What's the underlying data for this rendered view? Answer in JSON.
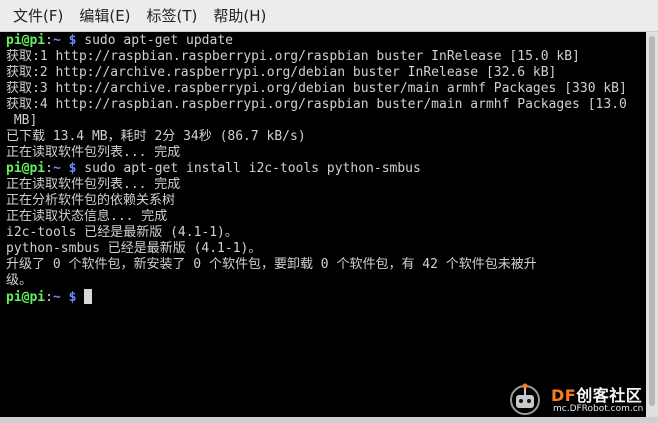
{
  "menubar": {
    "items": [
      "文件(F)",
      "编辑(E)",
      "标签(T)",
      "帮助(H)"
    ]
  },
  "terminal": {
    "prompt_user": "pi@pi",
    "prompt_sep": ":",
    "prompt_path": "~",
    "prompt_symbol": "$",
    "cmd1": "sudo apt-get update",
    "out1": [
      "获取:1 http://raspbian.raspberrypi.org/raspbian buster InRelease [15.0 kB]",
      "获取:2 http://archive.raspberrypi.org/debian buster InRelease [32.6 kB]",
      "获取:3 http://archive.raspberrypi.org/debian buster/main armhf Packages [330 kB]",
      "获取:4 http://raspbian.raspberrypi.org/raspbian buster/main armhf Packages [13.0",
      " MB]",
      "已下载 13.4 MB，耗时 2分 34秒 (86.7 kB/s)",
      "正在读取软件包列表... 完成"
    ],
    "cmd2": "sudo apt-get install i2c-tools python-smbus",
    "out2": [
      "正在读取软件包列表... 完成",
      "正在分析软件包的依赖关系树",
      "正在读取状态信息... 完成",
      "i2c-tools 已经是最新版 (4.1-1)。",
      "python-smbus 已经是最新版 (4.1-1)。",
      "升级了 0 个软件包，新安装了 0 个软件包，要卸载 0 个软件包，有 42 个软件包未被升",
      "级。"
    ]
  },
  "watermark": {
    "brand_df": "DF",
    "brand_rest": "创客社区",
    "url": "mc.DFRobot.com.cn"
  },
  "colors": {
    "prompt_user": "#5ff05f",
    "prompt_path": "#6a8cff",
    "text": "#d0d0d0",
    "background": "#000000",
    "brand_accent": "#ff7a1a"
  }
}
